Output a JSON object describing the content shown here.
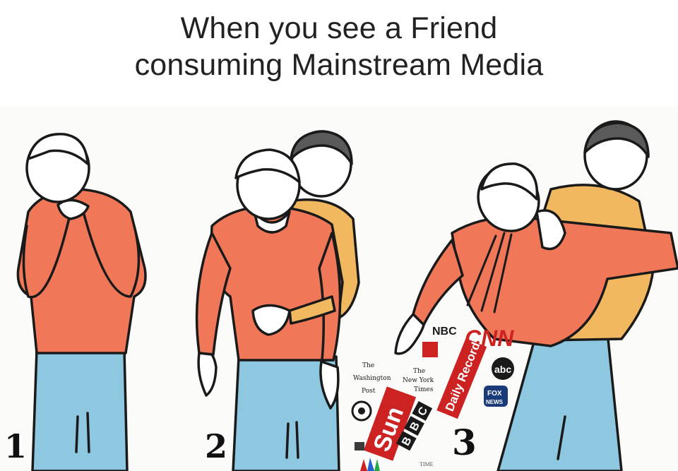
{
  "caption": {
    "line1": "When you see a Friend",
    "line2": "consuming Mainstream Media"
  },
  "panels": [
    {
      "number": "1"
    },
    {
      "number": "2"
    },
    {
      "number": "3"
    }
  ],
  "logos": {
    "nbc": "NBC",
    "cnn": "CNN",
    "abc": "abc",
    "fox": "FOX",
    "fox_sub": "NEWS",
    "daily_record": "Daily Record",
    "sun": "Sun",
    "bbc": [
      "B",
      "B",
      "C"
    ],
    "washington_post": [
      "The",
      "Washington",
      "Post"
    ],
    "nyt": [
      "The",
      "New York",
      "Times"
    ],
    "time": "TIME"
  },
  "colors": {
    "shirt": "#f07858",
    "shirt_yellow": "#f2b860",
    "pants": "#8ec8e0",
    "skin": "#ffffff",
    "hair_dark": "#5a5a5a",
    "outline": "#1a1a1a",
    "cnn_red": "#cc2222"
  }
}
